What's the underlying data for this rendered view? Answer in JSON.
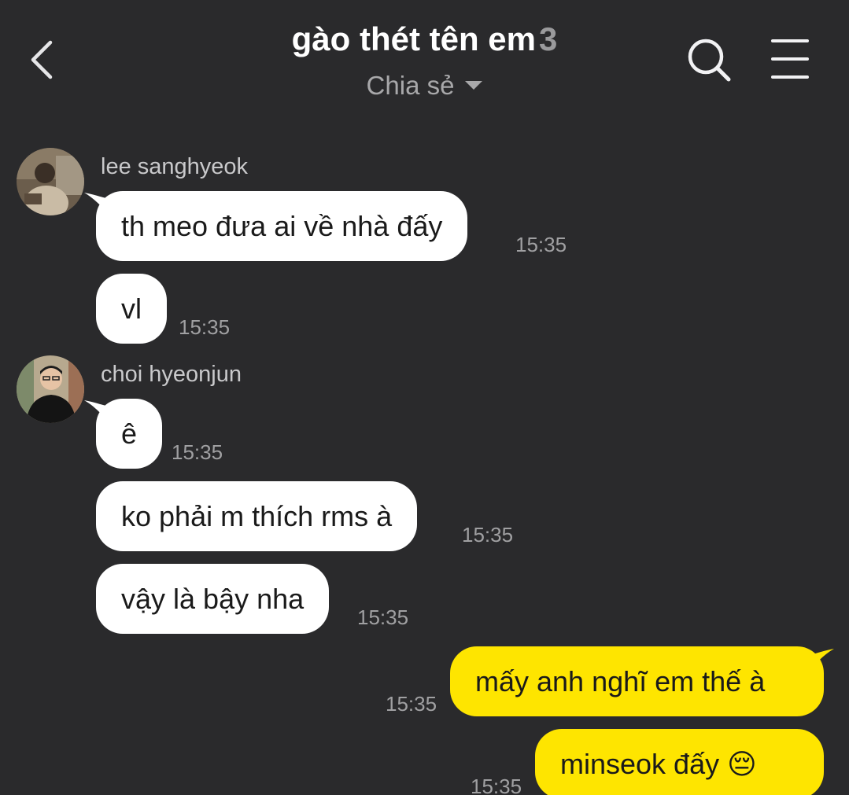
{
  "header": {
    "title": "gào thét tên em",
    "member_count": "3",
    "subtitle": "Chia sẻ"
  },
  "icons": {
    "back": "chevron-left-icon",
    "search": "search-icon",
    "menu": "menu-icon",
    "emoji": "pensive-face-emoji"
  },
  "colors": {
    "background": "#2a2a2c",
    "incoming_bubble": "#ffffff",
    "outgoing_bubble": "#fee500"
  },
  "messages": [
    {
      "sender": "lee sanghyeok",
      "text": "th meo đưa ai về nhà đấy",
      "time": "15:35",
      "direction": "in"
    },
    {
      "text": "vl",
      "time": "15:35",
      "direction": "in"
    },
    {
      "sender": "choi hyeonjun",
      "text": "ê",
      "time": "15:35",
      "direction": "in"
    },
    {
      "text": "ko phải m thích rms à",
      "time": "15:35",
      "direction": "in"
    },
    {
      "text": "vậy là bậy nha",
      "time": "15:35",
      "direction": "in"
    },
    {
      "text": "mấy anh nghĩ em thế à",
      "time": "15:35",
      "direction": "out"
    },
    {
      "text": "minseok đấy",
      "emoji": "😔",
      "time": "15:35",
      "direction": "out"
    }
  ]
}
